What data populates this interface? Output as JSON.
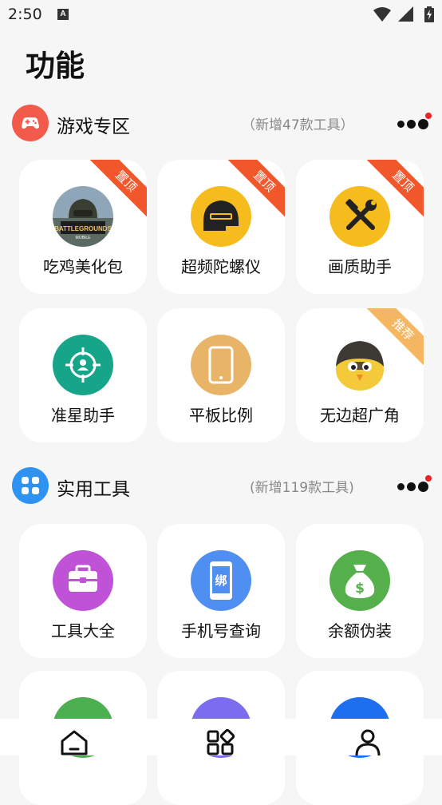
{
  "status_bar": {
    "time": "2:50",
    "notification_badge": "A"
  },
  "page": {
    "title": "功能"
  },
  "sections": [
    {
      "title": "游戏专区",
      "note": "（新增47款工具）",
      "icon": "gamepad-icon",
      "icon_color": "#f25a4c"
    },
    {
      "title": "实用工具",
      "note": "(新增119款工具)",
      "icon": "grid-apps-icon",
      "icon_color": "#2e93f0"
    }
  ],
  "game_tools": [
    {
      "label": "吃鸡美化包",
      "icon": "pubg-logo-icon",
      "ribbon": "置顶"
    },
    {
      "label": "超频陀螺仪",
      "icon": "helmet-icon",
      "icon_color": "#f6bb1c",
      "ribbon": "置顶"
    },
    {
      "label": "画质助手",
      "icon": "tools-wrench-hammer-icon",
      "icon_color": "#f6bb1c",
      "ribbon": "置顶"
    },
    {
      "label": "准星助手",
      "icon": "crosshair-icon",
      "icon_color": "#17a58a",
      "ribbon": ""
    },
    {
      "label": "平板比例",
      "icon": "tablet-icon",
      "icon_color": "#e8b468",
      "ribbon": ""
    },
    {
      "label": "无边超广角",
      "icon": "chick-helmet-icon",
      "ribbon": "推荐"
    }
  ],
  "utility_tools": [
    {
      "label": "工具大全",
      "icon": "toolbox-icon",
      "icon_color": "#c052d8"
    },
    {
      "label": "手机号查询",
      "icon": "phone-bind-icon",
      "icon_color": "#4f8ff2",
      "icon_text": "绑"
    },
    {
      "label": "余额伪装",
      "icon": "money-bag-icon",
      "icon_color": "#55b04c",
      "icon_text": "$"
    }
  ],
  "partial_row_colors": [
    "#4caf50",
    "#7b6cf0",
    "#1e6ff0"
  ],
  "bottom_nav": [
    {
      "name": "home",
      "icon": "home-icon"
    },
    {
      "name": "apps",
      "icon": "apps-icon"
    },
    {
      "name": "profile",
      "icon": "user-icon"
    }
  ]
}
